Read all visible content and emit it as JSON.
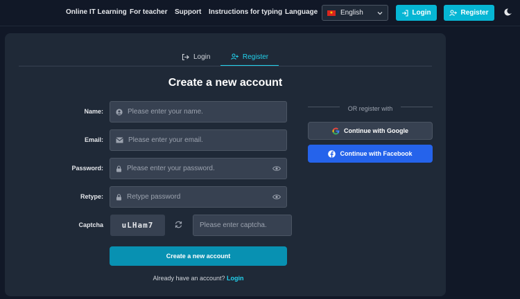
{
  "nav": {
    "links": [
      "Online IT Learning",
      "For teacher",
      "Support",
      "Instructions for typing",
      "Language"
    ],
    "language": {
      "selected": "English",
      "flag_icon": "vietnam-flag-icon"
    },
    "login_label": "Login",
    "register_label": "Register",
    "theme_icon": "moon-icon"
  },
  "colors": {
    "accent": "#06b6d4",
    "background": "#111827",
    "card": "#1f2937",
    "facebook": "#2563eb"
  },
  "tabs": [
    {
      "label": "Login",
      "icon": "login-icon",
      "active": false
    },
    {
      "label": "Register",
      "icon": "user-plus-icon",
      "active": true
    }
  ],
  "form": {
    "title": "Create a new account",
    "fields": {
      "name": {
        "label": "Name:",
        "placeholder": "Please enter your name.",
        "icon": "user-circle-icon"
      },
      "email": {
        "label": "Email:",
        "placeholder": "Please enter your email.",
        "icon": "envelope-icon"
      },
      "password": {
        "label": "Password:",
        "placeholder": "Please enter your password.",
        "icon": "lock-icon"
      },
      "retype": {
        "label": "Retype:",
        "placeholder": "Retype password",
        "icon": "lock-icon"
      }
    },
    "captcha": {
      "label": "Captcha",
      "code": "uLHam7",
      "placeholder": "Please enter captcha."
    },
    "submit_label": "Create a new account",
    "already_text": "Already have an account?",
    "login_link": "Login"
  },
  "social": {
    "or_text": "OR register with",
    "google_label": "Continue with Google",
    "facebook_label": "Continue with Facebook"
  }
}
